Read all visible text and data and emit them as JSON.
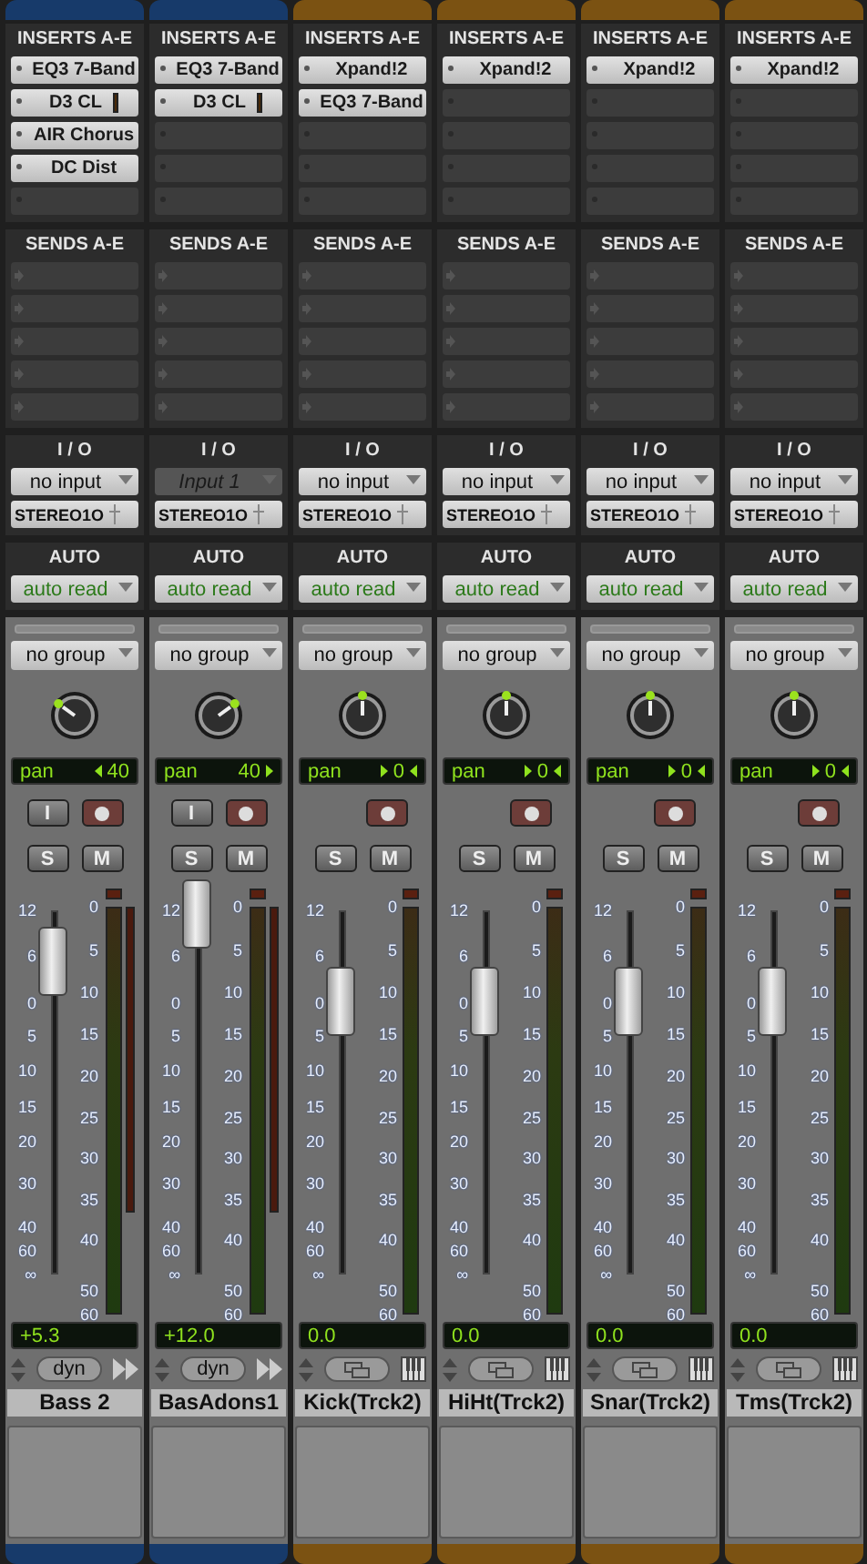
{
  "strips": [
    {
      "kind": "audio",
      "color": "#173a6a",
      "inserts_label": "INSERTS A-E",
      "inserts": [
        {
          "kind": "plugin",
          "name": "EQ3 7-Band"
        },
        {
          "kind": "meter_plugin",
          "name": "D3 CL"
        },
        {
          "kind": "plugin",
          "name": "AIR Chorus"
        },
        {
          "kind": "plugin",
          "name": "DC Dist"
        },
        {
          "kind": "empty"
        }
      ],
      "sends_label": "SENDS A-E",
      "sends": [
        {
          "kind": "empty"
        },
        {
          "kind": "empty"
        },
        {
          "kind": "empty"
        },
        {
          "kind": "empty"
        },
        {
          "kind": "empty"
        }
      ],
      "io_label": "I / O",
      "input": {
        "value": "no input",
        "active": true
      },
      "output": "STEREO1O",
      "auto_label": "AUTO",
      "automation": "auto read",
      "group": "no group",
      "pan": {
        "label": "pan",
        "value": "40",
        "level": 0.3
      },
      "input_button": "I",
      "solo": "S",
      "mute": "M",
      "fader_scale": [
        "12",
        "6",
        "0",
        "5",
        "10",
        "15",
        "20",
        "30",
        "40",
        "60",
        "∞"
      ],
      "meter_scale": [
        "0",
        "5",
        "10",
        "15",
        "20",
        "25",
        "30",
        "35",
        "40",
        "50",
        "60"
      ],
      "fader": {
        "level": 0.86
      },
      "volume": "+5.3",
      "plugin_button": "dyn",
      "name": "Bass 2"
    },
    {
      "kind": "audio",
      "color": "#173a6a",
      "inserts_label": "INSERTS A-E",
      "inserts": [
        {
          "kind": "plugin",
          "name": "EQ3 7-Band"
        },
        {
          "kind": "meter_plugin",
          "name": "D3 CL"
        },
        {
          "kind": "empty"
        },
        {
          "kind": "empty"
        },
        {
          "kind": "empty"
        }
      ],
      "sends_label": "SENDS A-E",
      "sends": [
        {
          "kind": "empty"
        },
        {
          "kind": "empty"
        },
        {
          "kind": "empty"
        },
        {
          "kind": "empty"
        },
        {
          "kind": "empty"
        }
      ],
      "io_label": "I / O",
      "input": {
        "value": "Input 1",
        "active": false
      },
      "output": "STEREO1O",
      "auto_label": "AUTO",
      "automation": "auto read",
      "group": "no group",
      "pan": {
        "label": "pan",
        "value": "40",
        "level": 0.7
      },
      "input_button": "I",
      "solo": "S",
      "mute": "M",
      "fader_scale": [
        "12",
        "6",
        "0",
        "5",
        "10",
        "15",
        "20",
        "30",
        "40",
        "60",
        "∞"
      ],
      "meter_scale": [
        "0",
        "5",
        "10",
        "15",
        "20",
        "25",
        "30",
        "35",
        "40",
        "50",
        "60"
      ],
      "fader": {
        "level": 0.99
      },
      "volume": "+12.0",
      "plugin_button": "dyn",
      "name": "BasAdons1"
    },
    {
      "kind": "instrument",
      "color": "#7b5212",
      "inserts_label": "INSERTS A-E",
      "inserts": [
        {
          "kind": "plugin",
          "name": "Xpand!2"
        },
        {
          "kind": "plugin",
          "name": "EQ3 7-Band"
        },
        {
          "kind": "empty"
        },
        {
          "kind": "empty"
        },
        {
          "kind": "empty"
        }
      ],
      "sends_label": "SENDS A-E",
      "sends": [
        {
          "kind": "empty"
        },
        {
          "kind": "empty"
        },
        {
          "kind": "empty"
        },
        {
          "kind": "empty"
        },
        {
          "kind": "empty"
        }
      ],
      "io_label": "I / O",
      "input": {
        "value": "no input",
        "active": true
      },
      "output": "STEREO1O",
      "auto_label": "AUTO",
      "automation": "auto read",
      "group": "no group",
      "pan": {
        "label": "pan",
        "value": "0",
        "level": 0.5
      },
      "solo": "S",
      "mute": "M",
      "fader_scale": [
        "12",
        "6",
        "0",
        "5",
        "10",
        "15",
        "20",
        "30",
        "40",
        "60",
        "∞"
      ],
      "meter_scale": [
        "0",
        "5",
        "10",
        "15",
        "20",
        "25",
        "30",
        "35",
        "40",
        "50",
        "60"
      ],
      "fader": {
        "level": 0.75
      },
      "volume": "0.0",
      "name": "Kick(Trck2)"
    },
    {
      "kind": "instrument",
      "color": "#7b5212",
      "inserts_label": "INSERTS A-E",
      "inserts": [
        {
          "kind": "plugin",
          "name": "Xpand!2"
        },
        {
          "kind": "empty"
        },
        {
          "kind": "empty"
        },
        {
          "kind": "empty"
        },
        {
          "kind": "empty"
        }
      ],
      "sends_label": "SENDS A-E",
      "sends": [
        {
          "kind": "empty"
        },
        {
          "kind": "empty"
        },
        {
          "kind": "empty"
        },
        {
          "kind": "empty"
        },
        {
          "kind": "empty"
        }
      ],
      "io_label": "I / O",
      "input": {
        "value": "no input",
        "active": true
      },
      "output": "STEREO1O",
      "auto_label": "AUTO",
      "automation": "auto read",
      "group": "no group",
      "pan": {
        "label": "pan",
        "value": "0",
        "level": 0.5
      },
      "solo": "S",
      "mute": "M",
      "fader_scale": [
        "12",
        "6",
        "0",
        "5",
        "10",
        "15",
        "20",
        "30",
        "40",
        "60",
        "∞"
      ],
      "meter_scale": [
        "0",
        "5",
        "10",
        "15",
        "20",
        "25",
        "30",
        "35",
        "40",
        "50",
        "60"
      ],
      "fader": {
        "level": 0.75
      },
      "volume": "0.0",
      "name": "HiHt(Trck2)"
    },
    {
      "kind": "instrument",
      "color": "#7b5212",
      "inserts_label": "INSERTS A-E",
      "inserts": [
        {
          "kind": "plugin",
          "name": "Xpand!2"
        },
        {
          "kind": "empty"
        },
        {
          "kind": "empty"
        },
        {
          "kind": "empty"
        },
        {
          "kind": "empty"
        }
      ],
      "sends_label": "SENDS A-E",
      "sends": [
        {
          "kind": "empty"
        },
        {
          "kind": "empty"
        },
        {
          "kind": "empty"
        },
        {
          "kind": "empty"
        },
        {
          "kind": "empty"
        }
      ],
      "io_label": "I / O",
      "input": {
        "value": "no input",
        "active": true
      },
      "output": "STEREO1O",
      "auto_label": "AUTO",
      "automation": "auto read",
      "group": "no group",
      "pan": {
        "label": "pan",
        "value": "0",
        "level": 0.5
      },
      "solo": "S",
      "mute": "M",
      "fader_scale": [
        "12",
        "6",
        "0",
        "5",
        "10",
        "15",
        "20",
        "30",
        "40",
        "60",
        "∞"
      ],
      "meter_scale": [
        "0",
        "5",
        "10",
        "15",
        "20",
        "25",
        "30",
        "35",
        "40",
        "50",
        "60"
      ],
      "fader": {
        "level": 0.75
      },
      "volume": "0.0",
      "name": "Snar(Trck2)"
    },
    {
      "kind": "instrument",
      "color": "#7b5212",
      "inserts_label": "INSERTS A-E",
      "inserts": [
        {
          "kind": "plugin",
          "name": "Xpand!2"
        },
        {
          "kind": "empty"
        },
        {
          "kind": "empty"
        },
        {
          "kind": "empty"
        },
        {
          "kind": "empty"
        }
      ],
      "sends_label": "SENDS A-E",
      "sends": [
        {
          "kind": "empty"
        },
        {
          "kind": "empty"
        },
        {
          "kind": "empty"
        },
        {
          "kind": "empty"
        },
        {
          "kind": "empty"
        }
      ],
      "io_label": "I / O",
      "input": {
        "value": "no input",
        "active": true
      },
      "output": "STEREO1O",
      "auto_label": "AUTO",
      "automation": "auto read",
      "group": "no group",
      "pan": {
        "label": "pan",
        "value": "0",
        "level": 0.5
      },
      "solo": "S",
      "mute": "M",
      "fader_scale": [
        "12",
        "6",
        "0",
        "5",
        "10",
        "15",
        "20",
        "30",
        "40",
        "60",
        "∞"
      ],
      "meter_scale": [
        "0",
        "5",
        "10",
        "15",
        "20",
        "25",
        "30",
        "35",
        "40",
        "50",
        "60"
      ],
      "fader": {
        "level": 0.75
      },
      "volume": "0.0",
      "name": "Tms(Trck2)"
    }
  ]
}
